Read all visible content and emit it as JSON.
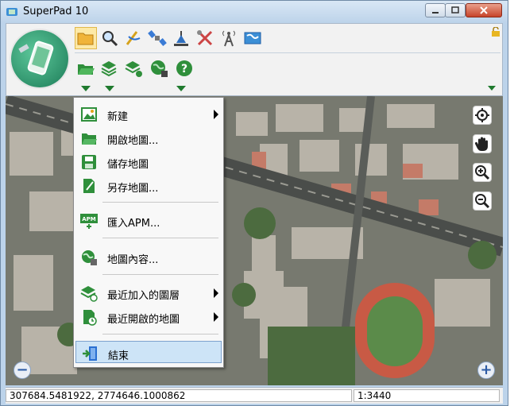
{
  "window": {
    "title": "SuperPad 10"
  },
  "colors": {
    "accent": "#1f7a2e",
    "menu_highlight": "#cde4f7",
    "title_bar": "#bdd3ea"
  },
  "ribbon": {
    "tabs": [
      "folder-icon",
      "search-icon",
      "draw-icon",
      "satellite-icon",
      "survey-icon",
      "tools-icon",
      "gps-tower-icon",
      "map-icon"
    ],
    "tools": [
      "open-icon",
      "add-layer-icon",
      "layer-settings-icon",
      "globe-icon",
      "help-icon"
    ]
  },
  "menu": {
    "items": [
      {
        "label": "新建",
        "icon": "picture-icon",
        "submenu": true
      },
      {
        "label": "開啟地圖...",
        "icon": "folder-icon",
        "submenu": false
      },
      {
        "label": "儲存地圖",
        "icon": "save-icon",
        "submenu": false
      },
      {
        "label": "另存地圖...",
        "icon": "save-as-icon",
        "submenu": false
      },
      {
        "label": "匯入APM...",
        "icon": "apm-icon",
        "submenu": false
      },
      {
        "label": "地圖內容...",
        "icon": "map-content-icon",
        "submenu": false
      },
      {
        "label": "最近加入的圖層",
        "icon": "recent-layer-icon",
        "submenu": true
      },
      {
        "label": "最近開啟的地圖",
        "icon": "recent-map-icon",
        "submenu": true
      },
      {
        "label": "結束",
        "icon": "exit-icon",
        "submenu": false
      }
    ]
  },
  "statusbar": {
    "coordinates": "307684.5481922, 2774646.1000862",
    "scale": "1:3440"
  }
}
